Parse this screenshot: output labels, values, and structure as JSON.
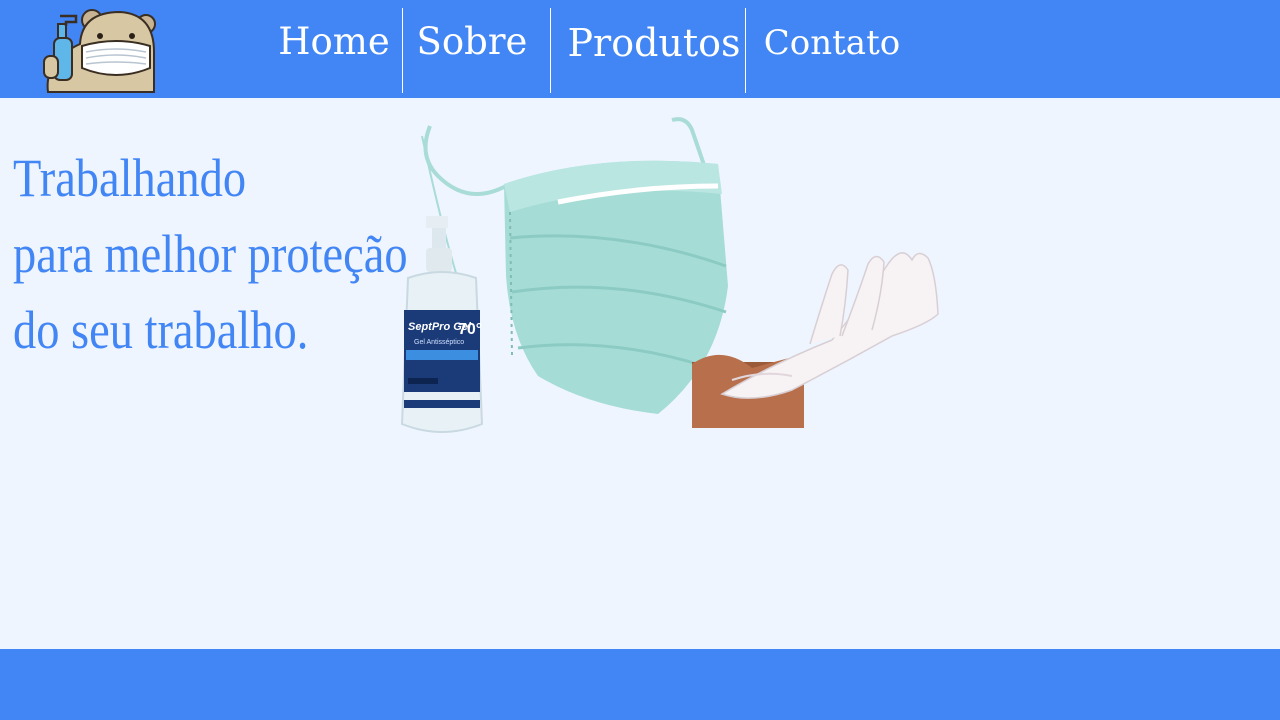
{
  "nav": {
    "items": [
      {
        "label": "Home"
      },
      {
        "label": "Sobre"
      },
      {
        "label": "Produtos"
      },
      {
        "label": "Contato"
      }
    ]
  },
  "hero": {
    "headline_lines": [
      "Trabalhando",
      "para melhor proteção",
      "do seu trabalho."
    ]
  },
  "products": {
    "gel_label_brand": "SeptPro Gel",
    "gel_label_percent": "70°",
    "gel_label_sub": "Gel Antisséptico"
  },
  "colors": {
    "primary": "#4285f4",
    "background": "#eef5fe"
  },
  "icons": {
    "logo": "bear-with-mask-and-sanitizer-icon"
  }
}
